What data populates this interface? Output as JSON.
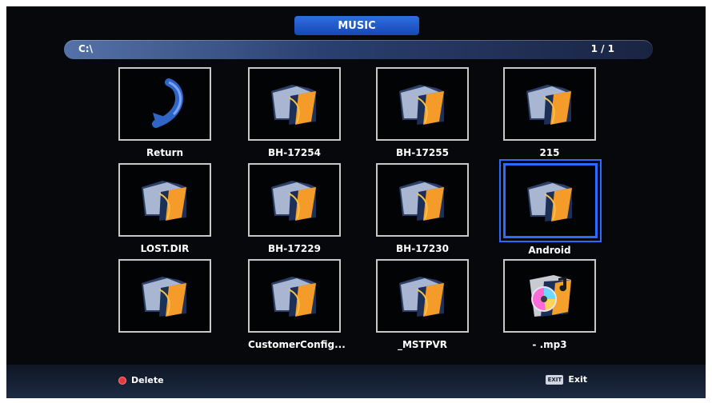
{
  "header": {
    "title": "MUSIC",
    "path": "C:\\",
    "page": "1 / 1"
  },
  "items": [
    {
      "label": "Return",
      "icon": "return-arrow-icon"
    },
    {
      "label": "BH-17254",
      "icon": "folder-icon"
    },
    {
      "label": "BH-17255",
      "icon": "folder-icon"
    },
    {
      "label": "215",
      "icon": "folder-icon"
    },
    {
      "label": "LOST.DIR",
      "icon": "folder-icon"
    },
    {
      "label": "BH-17229",
      "icon": "folder-icon"
    },
    {
      "label": "BH-17230",
      "icon": "folder-icon"
    },
    {
      "label": "Android",
      "icon": "folder-icon",
      "selected": true
    },
    {
      "label": "",
      "icon": "folder-icon"
    },
    {
      "label": "CustomerConfig...",
      "icon": "folder-icon"
    },
    {
      "label": "_MSTPVR",
      "icon": "folder-icon"
    },
    {
      "label": "- .mp3",
      "icon": "music-file-icon"
    }
  ],
  "footer": {
    "delete_label": "Delete",
    "exit_key_label": "EXIT",
    "exit_label": "Exit"
  },
  "colors": {
    "accent": "#2c6bff",
    "background": "#06080b",
    "title_tab": "#1f57d0"
  }
}
